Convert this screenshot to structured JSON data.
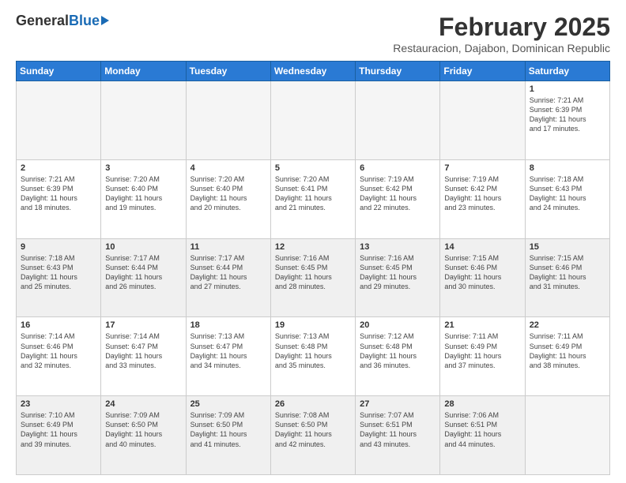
{
  "header": {
    "logo_general": "General",
    "logo_blue": "Blue",
    "month_title": "February 2025",
    "subtitle": "Restauracion, Dajabon, Dominican Republic"
  },
  "days_of_week": [
    "Sunday",
    "Monday",
    "Tuesday",
    "Wednesday",
    "Thursday",
    "Friday",
    "Saturday"
  ],
  "weeks": [
    [
      {
        "day": "",
        "info": "",
        "empty": true
      },
      {
        "day": "",
        "info": "",
        "empty": true
      },
      {
        "day": "",
        "info": "",
        "empty": true
      },
      {
        "day": "",
        "info": "",
        "empty": true
      },
      {
        "day": "",
        "info": "",
        "empty": true
      },
      {
        "day": "",
        "info": "",
        "empty": true
      },
      {
        "day": "1",
        "info": "Sunrise: 7:21 AM\nSunset: 6:39 PM\nDaylight: 11 hours\nand 17 minutes."
      }
    ],
    [
      {
        "day": "2",
        "info": "Sunrise: 7:21 AM\nSunset: 6:39 PM\nDaylight: 11 hours\nand 18 minutes."
      },
      {
        "day": "3",
        "info": "Sunrise: 7:20 AM\nSunset: 6:40 PM\nDaylight: 11 hours\nand 19 minutes."
      },
      {
        "day": "4",
        "info": "Sunrise: 7:20 AM\nSunset: 6:40 PM\nDaylight: 11 hours\nand 20 minutes."
      },
      {
        "day": "5",
        "info": "Sunrise: 7:20 AM\nSunset: 6:41 PM\nDaylight: 11 hours\nand 21 minutes."
      },
      {
        "day": "6",
        "info": "Sunrise: 7:19 AM\nSunset: 6:42 PM\nDaylight: 11 hours\nand 22 minutes."
      },
      {
        "day": "7",
        "info": "Sunrise: 7:19 AM\nSunset: 6:42 PM\nDaylight: 11 hours\nand 23 minutes."
      },
      {
        "day": "8",
        "info": "Sunrise: 7:18 AM\nSunset: 6:43 PM\nDaylight: 11 hours\nand 24 minutes."
      }
    ],
    [
      {
        "day": "9",
        "info": "Sunrise: 7:18 AM\nSunset: 6:43 PM\nDaylight: 11 hours\nand 25 minutes.",
        "shaded": true
      },
      {
        "day": "10",
        "info": "Sunrise: 7:17 AM\nSunset: 6:44 PM\nDaylight: 11 hours\nand 26 minutes.",
        "shaded": true
      },
      {
        "day": "11",
        "info": "Sunrise: 7:17 AM\nSunset: 6:44 PM\nDaylight: 11 hours\nand 27 minutes.",
        "shaded": true
      },
      {
        "day": "12",
        "info": "Sunrise: 7:16 AM\nSunset: 6:45 PM\nDaylight: 11 hours\nand 28 minutes.",
        "shaded": true
      },
      {
        "day": "13",
        "info": "Sunrise: 7:16 AM\nSunset: 6:45 PM\nDaylight: 11 hours\nand 29 minutes.",
        "shaded": true
      },
      {
        "day": "14",
        "info": "Sunrise: 7:15 AM\nSunset: 6:46 PM\nDaylight: 11 hours\nand 30 minutes.",
        "shaded": true
      },
      {
        "day": "15",
        "info": "Sunrise: 7:15 AM\nSunset: 6:46 PM\nDaylight: 11 hours\nand 31 minutes.",
        "shaded": true
      }
    ],
    [
      {
        "day": "16",
        "info": "Sunrise: 7:14 AM\nSunset: 6:46 PM\nDaylight: 11 hours\nand 32 minutes."
      },
      {
        "day": "17",
        "info": "Sunrise: 7:14 AM\nSunset: 6:47 PM\nDaylight: 11 hours\nand 33 minutes."
      },
      {
        "day": "18",
        "info": "Sunrise: 7:13 AM\nSunset: 6:47 PM\nDaylight: 11 hours\nand 34 minutes."
      },
      {
        "day": "19",
        "info": "Sunrise: 7:13 AM\nSunset: 6:48 PM\nDaylight: 11 hours\nand 35 minutes."
      },
      {
        "day": "20",
        "info": "Sunrise: 7:12 AM\nSunset: 6:48 PM\nDaylight: 11 hours\nand 36 minutes."
      },
      {
        "day": "21",
        "info": "Sunrise: 7:11 AM\nSunset: 6:49 PM\nDaylight: 11 hours\nand 37 minutes."
      },
      {
        "day": "22",
        "info": "Sunrise: 7:11 AM\nSunset: 6:49 PM\nDaylight: 11 hours\nand 38 minutes."
      }
    ],
    [
      {
        "day": "23",
        "info": "Sunrise: 7:10 AM\nSunset: 6:49 PM\nDaylight: 11 hours\nand 39 minutes.",
        "shaded": true
      },
      {
        "day": "24",
        "info": "Sunrise: 7:09 AM\nSunset: 6:50 PM\nDaylight: 11 hours\nand 40 minutes.",
        "shaded": true
      },
      {
        "day": "25",
        "info": "Sunrise: 7:09 AM\nSunset: 6:50 PM\nDaylight: 11 hours\nand 41 minutes.",
        "shaded": true
      },
      {
        "day": "26",
        "info": "Sunrise: 7:08 AM\nSunset: 6:50 PM\nDaylight: 11 hours\nand 42 minutes.",
        "shaded": true
      },
      {
        "day": "27",
        "info": "Sunrise: 7:07 AM\nSunset: 6:51 PM\nDaylight: 11 hours\nand 43 minutes.",
        "shaded": true
      },
      {
        "day": "28",
        "info": "Sunrise: 7:06 AM\nSunset: 6:51 PM\nDaylight: 11 hours\nand 44 minutes.",
        "shaded": true
      },
      {
        "day": "",
        "info": "",
        "empty": true,
        "shaded": true
      }
    ]
  ]
}
